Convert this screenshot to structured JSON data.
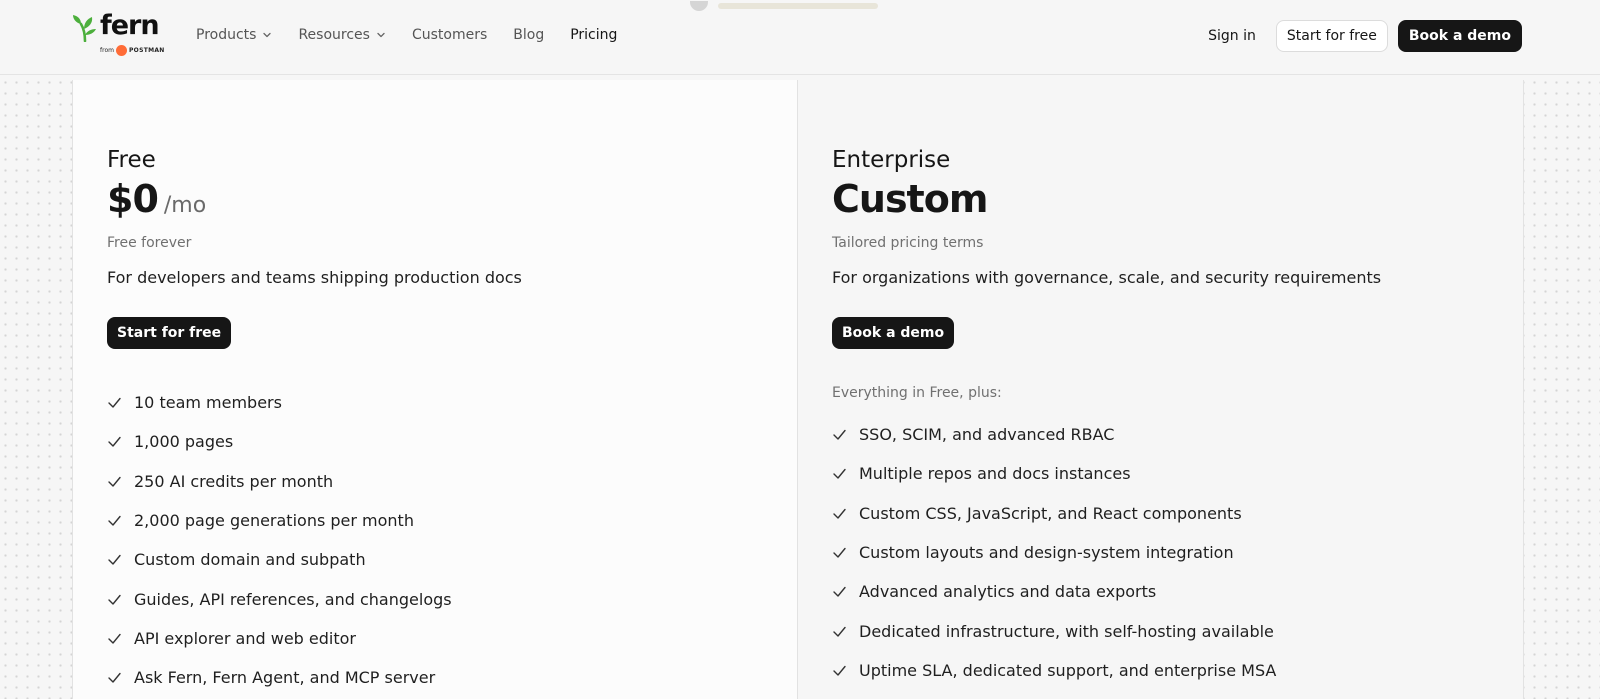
{
  "brand": {
    "name": "fern",
    "sub_from": "from",
    "sub_postman": "POSTMAN",
    "leaf_color": "#4caf3c",
    "postman_color": "#ff6c37"
  },
  "nav": {
    "items": [
      {
        "label": "Products",
        "has_dropdown": true
      },
      {
        "label": "Resources",
        "has_dropdown": true
      },
      {
        "label": "Customers",
        "has_dropdown": false
      },
      {
        "label": "Blog",
        "has_dropdown": false
      },
      {
        "label": "Pricing",
        "has_dropdown": false,
        "active": true
      }
    ]
  },
  "header_actions": {
    "sign_in": "Sign in",
    "start_free": "Start for free",
    "book_demo": "Book a demo"
  },
  "plans": {
    "free": {
      "name": "Free",
      "price": "$0",
      "period": "/mo",
      "price_note": "Free forever",
      "description": "For developers and teams shipping production docs",
      "cta": "Start for free",
      "features": [
        "10 team members",
        "1,000 pages",
        "250 AI credits per month",
        "2,000 page generations per month",
        "Custom domain and subpath",
        "Guides, API references, and changelogs",
        "API explorer and web editor",
        "Ask Fern, Fern Agent, and MCP server"
      ]
    },
    "enterprise": {
      "name": "Enterprise",
      "price": "Custom",
      "price_note": "Tailored pricing terms",
      "description": "For organizations with governance, scale, and security requirements",
      "cta": "Book a demo",
      "includes_label": "Everything in Free, plus:",
      "features": [
        "SSO, SCIM, and advanced RBAC",
        "Multiple repos and docs instances",
        "Custom CSS, JavaScript, and React components",
        "Custom layouts and design-system integration",
        "Advanced analytics and data exports",
        "Dedicated infrastructure, with self-hosting available",
        "Uptime SLA, dedicated support, and enterprise MSA"
      ]
    }
  },
  "colors": {
    "background": "#f6f6f6",
    "primary_button": "#161616",
    "text": "#161616",
    "muted_text": "#707070"
  }
}
